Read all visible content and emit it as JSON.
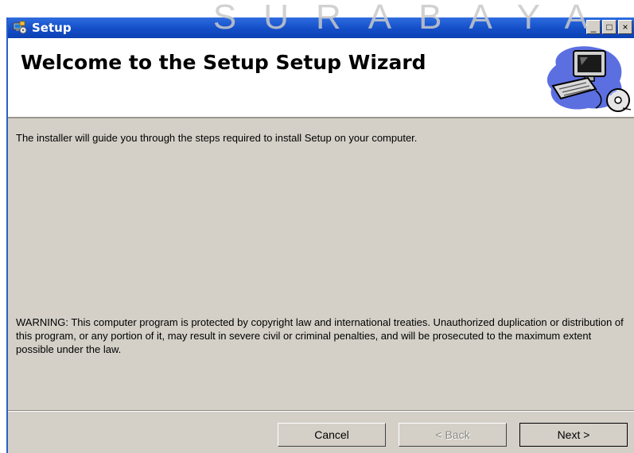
{
  "watermark": "SURABAYA",
  "window": {
    "title": "Setup",
    "controls": {
      "minimize": "_",
      "maximize": "□",
      "close": "×"
    }
  },
  "header": {
    "title": "Welcome to the Setup Setup Wizard",
    "art_icon": "computer-disc-icon"
  },
  "body": {
    "intro": "The installer will guide you through the steps required to install Setup on your computer.",
    "warning": "WARNING: This computer program is protected by copyright law and international treaties. Unauthorized duplication or distribution of this program, or any portion of it, may result in severe civil or criminal penalties, and will be prosecuted to the maximum extent possible under the law."
  },
  "buttons": {
    "cancel": "Cancel",
    "back": "< Back",
    "next": "Next >"
  },
  "colors": {
    "titlebar": "#1550c9",
    "face": "#d4d0c8",
    "header_bg": "#ffffff",
    "disabled_text": "#8c8a84"
  }
}
